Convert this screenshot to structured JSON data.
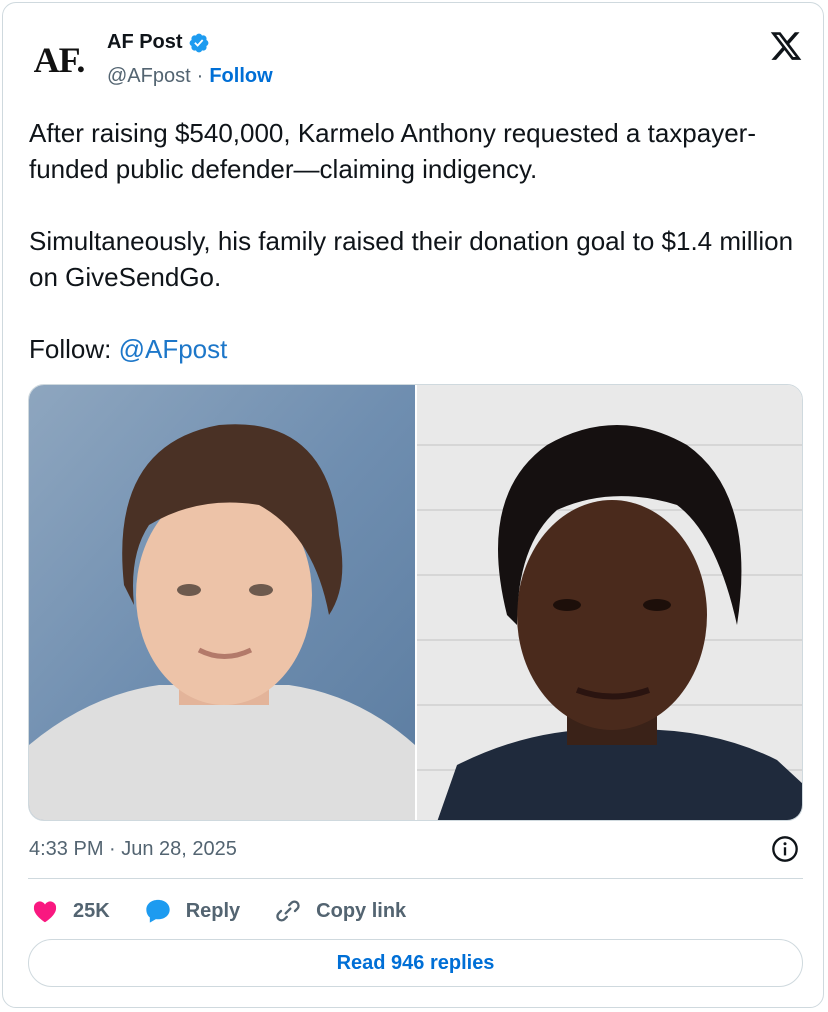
{
  "author": {
    "avatar_text": "AF.",
    "name": "AF Post",
    "handle": "@AFpost",
    "separator": "·",
    "follow_label": "Follow",
    "verified_color": "#1d9bf0"
  },
  "brand_icon": "x-logo-icon",
  "tweet": {
    "paragraph_1": "After raising $540,000, Karmelo Anthony requested a taxpayer-funded public defender—claiming indigency.",
    "paragraph_2": "Simultaneously, his family raised their donation goal to $1.4 million on GiveSendGo.",
    "follow_prefix": "Follow: ",
    "follow_mention": "@AFpost"
  },
  "media": {
    "count": 2,
    "images": [
      "photo-left",
      "photo-right"
    ]
  },
  "meta": {
    "timestamp": "4:33 PM · Jun 28, 2025",
    "info_icon": "info-icon"
  },
  "actions": {
    "like_count": "25K",
    "like_color": "#f91880",
    "reply_label": "Reply",
    "reply_color": "#1d9bf0",
    "copy_label": "Copy link"
  },
  "read_replies_label": "Read 946 replies"
}
